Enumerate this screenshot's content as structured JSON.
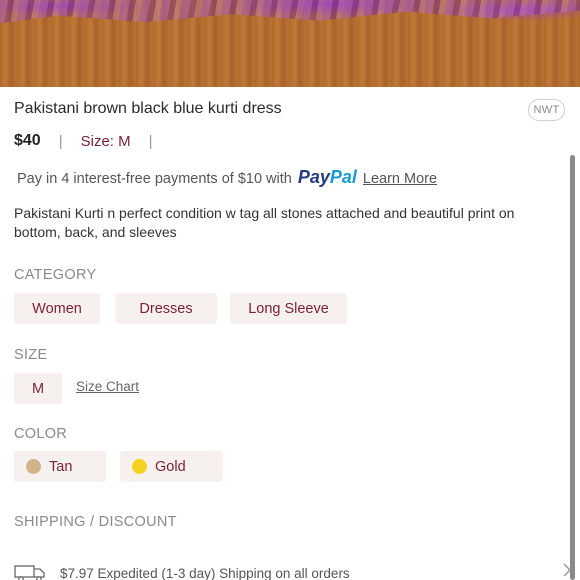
{
  "listing": {
    "title": "Pakistani brown black blue kurti dress",
    "condition_badge": "NWT",
    "price": "$40",
    "size_label": "Size: M",
    "separator": "|",
    "paypal_prefix": "Pay in 4 interest-free payments of $10 with",
    "paypal_logo_part1": "Pay",
    "paypal_logo_part2": "Pal",
    "paypal_learn_more": "Learn More",
    "description": "Pakistani Kurti n perfect condition w tag all stones attached and beautiful print on bottom, back, and sleeves"
  },
  "category": {
    "heading": "CATEGORY",
    "chips": [
      "Women",
      "Dresses",
      "Long Sleeve"
    ]
  },
  "size": {
    "heading": "SIZE",
    "value": "M",
    "size_chart_link": "Size Chart"
  },
  "color": {
    "heading": "COLOR",
    "chips": [
      {
        "label": "Tan",
        "swatch": "#d2b48c"
      },
      {
        "label": "Gold",
        "swatch": "#f5d21f"
      }
    ]
  },
  "shipping": {
    "heading": "SHIPPING / DISCOUNT",
    "text": "$7.97 Expedited (1-3 day) Shipping on all orders"
  },
  "icons": {
    "truck": "truck-icon",
    "chevron": "chevron-right-icon"
  },
  "colors": {
    "accent": "#7a1f3a",
    "chip_bg": "#f6f1ee",
    "paypal_dark": "#253b80",
    "paypal_light": "#179bd7"
  }
}
